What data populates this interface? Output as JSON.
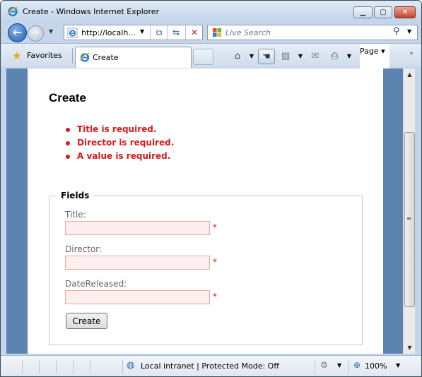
{
  "window": {
    "title": "Create - Windows Internet Explorer",
    "min_icon": "minimize-icon",
    "max_icon": "maximize-icon",
    "close_icon": "close-icon"
  },
  "nav": {
    "address_url": "http://localh...",
    "search_placeholder": "Live Search"
  },
  "toolbar": {
    "favorites_label": "Favorites",
    "tab_title": "Create",
    "page_menu": "Page"
  },
  "page": {
    "heading": "Create",
    "errors": [
      "Title is required.",
      "Director is required.",
      "A value is required."
    ],
    "fieldset_legend": "Fields",
    "fields": [
      {
        "label": "Title:",
        "value": "",
        "marker": "*"
      },
      {
        "label": "Director:",
        "value": "",
        "marker": "*"
      },
      {
        "label": "DateReleased:",
        "value": "",
        "marker": "*"
      }
    ],
    "submit_label": "Create"
  },
  "status": {
    "zone_text": "Local intranet | Protected Mode: Off",
    "zoom": "100%"
  },
  "colors": {
    "error_red": "#d41c1c",
    "invalid_input_bg": "#ffeeee",
    "page_margin_blue": "#5b84b1",
    "chrome_blue": "#c5d6ea"
  }
}
